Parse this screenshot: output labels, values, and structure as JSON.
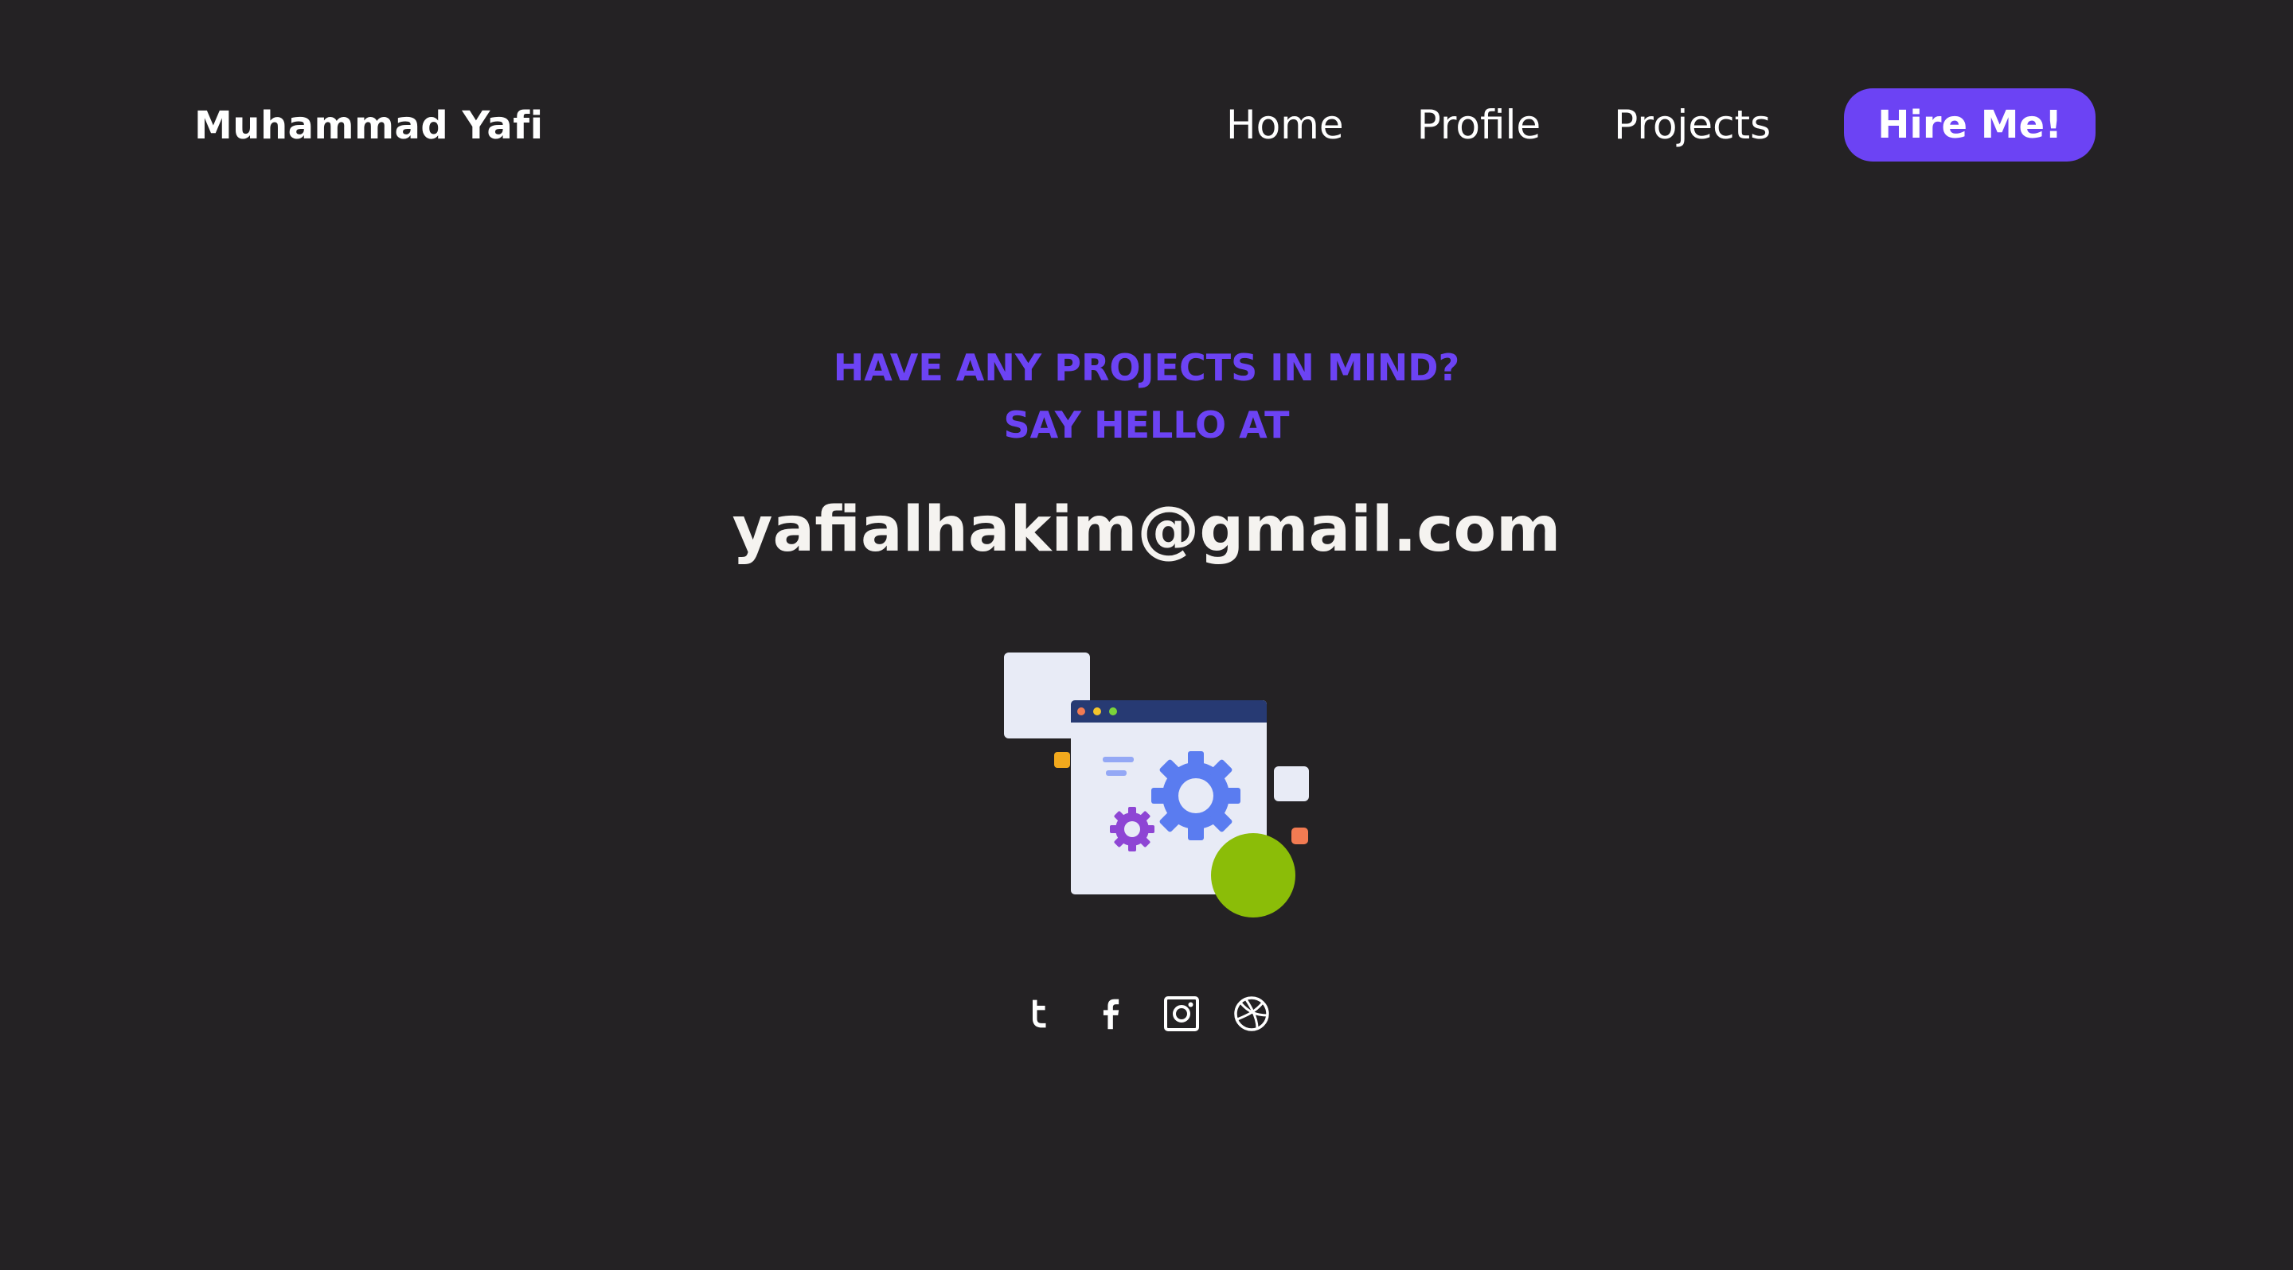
{
  "nav": {
    "brand": "Muhammad Yafi",
    "links": [
      "Home",
      "Profile",
      "Projects"
    ],
    "cta": "Hire Me!"
  },
  "contact": {
    "headline_line1": "HAVE ANY PROJECTS IN MIND?",
    "headline_line2": "SAY HELLO AT",
    "email": "yafialhakim@gmail.com"
  },
  "illustration": {
    "icon": "settings-window-illustration"
  },
  "social": [
    {
      "icon": "twitter-icon"
    },
    {
      "icon": "facebook-icon"
    },
    {
      "icon": "instagram-icon"
    },
    {
      "icon": "dribbble-icon"
    }
  ],
  "colors": {
    "background": "#242224",
    "accent": "#6c43f4",
    "text": "#ffffff"
  }
}
